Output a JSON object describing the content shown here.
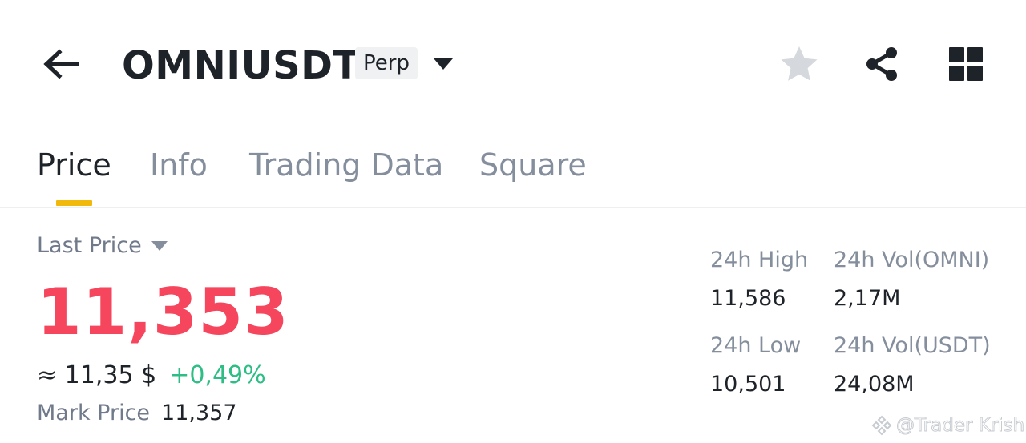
{
  "header": {
    "symbol": "OMNIUSDT",
    "contract_type": "Perp",
    "icons": {
      "back": "arrow-left-icon",
      "dropdown": "caret-down-icon",
      "favorite": "star-icon",
      "share": "share-icon",
      "more": "grid-icon"
    }
  },
  "tabs": [
    {
      "label": "Price",
      "active": true
    },
    {
      "label": "Info",
      "active": false
    },
    {
      "label": "Trading Data",
      "active": false
    },
    {
      "label": "Square",
      "active": false
    }
  ],
  "price": {
    "selector_label": "Last Price",
    "last_price": "11,353",
    "fiat_value": "≈ 11,35 $",
    "change_pct": "+0,49%",
    "mark_price_label": "Mark Price",
    "mark_price": "11,357"
  },
  "stats": {
    "high_label": "24h High",
    "high_value": "11,586",
    "vol_base_label": "24h Vol(OMNI)",
    "vol_base_value": "2,17M",
    "low_label": "24h Low",
    "low_value": "10,501",
    "vol_quote_label": "24h Vol(USDT)",
    "vol_quote_value": "24,08M"
  },
  "watermark": {
    "text": "@Trader Krish"
  },
  "colors": {
    "text_primary": "#1e2329",
    "text_secondary": "#848e9c",
    "price_down": "#f6465d",
    "price_up": "#2ebd85",
    "accent": "#f0b90b",
    "star_inactive": "#d5d8dc"
  }
}
